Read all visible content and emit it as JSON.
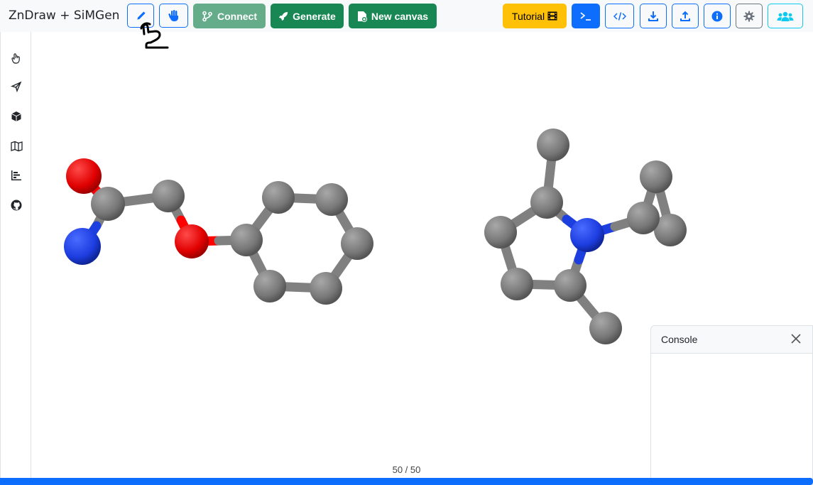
{
  "app": {
    "title": "ZnDraw + SiMGen"
  },
  "toolbar": {
    "connect_label": "Connect",
    "generate_label": "Generate",
    "new_canvas_label": "New canvas",
    "tutorial_label": "Tutorial"
  },
  "sidebar": {
    "items": [
      "pointer-hand-icon",
      "send-icon",
      "box-icon",
      "map-icon",
      "bar-chart-icon",
      "github-icon"
    ]
  },
  "console": {
    "title": "Console"
  },
  "player": {
    "frame": "50 / 50",
    "progress": 1.0
  },
  "colors": {
    "primary": "#0d6efd",
    "success": "#198754",
    "warning": "#ffc107",
    "info": "#0dcaf0",
    "carbon": "#808080",
    "oxygen": "#ff0000",
    "nitrogen": "#1e3fe0"
  }
}
